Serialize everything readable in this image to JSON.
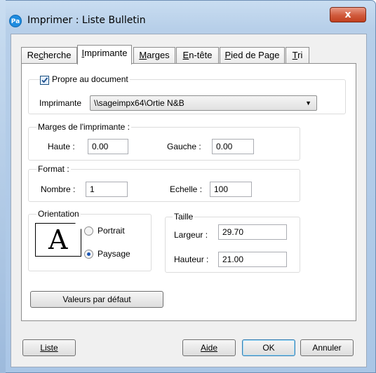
{
  "window": {
    "app_icon_text": "Pa",
    "title": "Imprimer : Liste Bulletin",
    "close_glyph": "x"
  },
  "tabs": [
    {
      "label": "Recherche",
      "underline_index": 2,
      "active": false
    },
    {
      "label": "Imprimante",
      "underline_index": 0,
      "active": true
    },
    {
      "label": "Marges",
      "underline_index": 0,
      "active": false
    },
    {
      "label": "En-tête",
      "underline_index": 0,
      "active": false
    },
    {
      "label": "Pied de Page",
      "underline_index": 0,
      "active": false
    },
    {
      "label": "Tri",
      "underline_index": 0,
      "active": false
    }
  ],
  "printer_group": {
    "checkbox_label": "Propre au document",
    "checked": true,
    "printer_label": "Imprimante",
    "printer_value": "\\\\sageimpx64\\Ortie N&B"
  },
  "margins_group": {
    "legend": "Marges de l'imprimante :",
    "top_label": "Haute :",
    "top_value": "0.00",
    "left_label": "Gauche :",
    "left_value": "0.00"
  },
  "format_group": {
    "legend": "Format :",
    "count_label": "Nombre :",
    "count_value": "1",
    "scale_label": "Echelle :",
    "scale_value": "100"
  },
  "orientation_group": {
    "legend": "Orientation",
    "page_glyph": "A",
    "portrait_label": "Portrait",
    "landscape_label": "Paysage",
    "selected": "Paysage"
  },
  "size_group": {
    "legend": "Taille",
    "width_label": "Largeur :",
    "width_value": "29.70",
    "height_label": "Hauteur :",
    "height_value": "21.00"
  },
  "defaults_button": "Valeurs par défaut",
  "footer": {
    "list_button": "Liste",
    "help_button": "Aide",
    "ok_button": "OK",
    "cancel_button": "Annuler"
  }
}
